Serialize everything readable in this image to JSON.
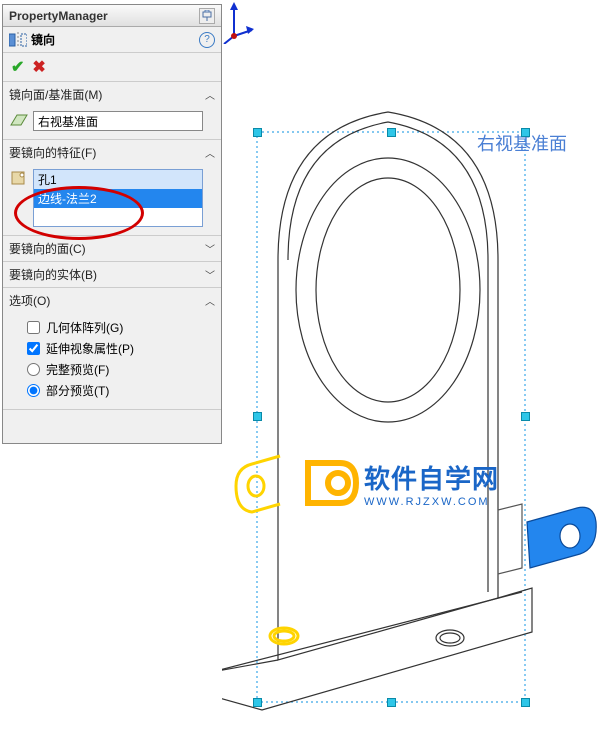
{
  "panel": {
    "title": "PropertyManager",
    "featureName": "镜向",
    "help": "?",
    "sections": {
      "mirrorPlane": {
        "title": "镜向面/基准面(M)",
        "value": "右视基准面"
      },
      "featuresToMirror": {
        "title": "要镜向的特征(F)",
        "items": [
          "孔1",
          "边线-法兰2"
        ]
      },
      "facesToMirror": {
        "title": "要镜向的面(C)"
      },
      "bodiesToMirror": {
        "title": "要镜向的实体(B)"
      },
      "options": {
        "title": "选项(O)",
        "geomPattern": "几何体阵列(G)",
        "propVisual": "延伸视象属性(P)",
        "fullPreview": "完整预览(F)",
        "partialPreview": "部分预览(T)"
      }
    }
  },
  "viewport": {
    "planeLabel": "右视基准面"
  },
  "watermark": {
    "main": "软件自学网",
    "sub": "WWW.RJZXW.COM"
  }
}
